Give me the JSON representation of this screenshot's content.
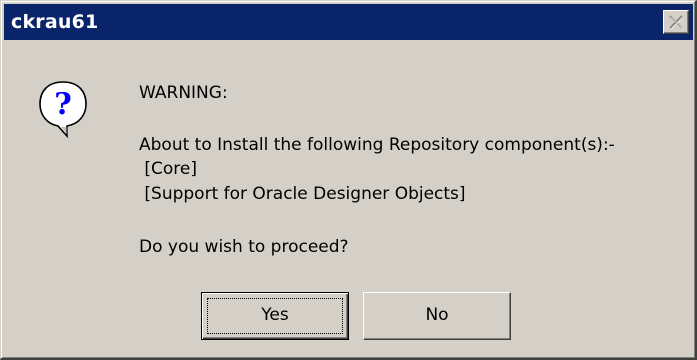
{
  "window": {
    "title": "ckrau61",
    "close_icon": "close-icon"
  },
  "message": {
    "icon": "question-icon",
    "warning": "WARNING:",
    "install_line": "About to Install the following Repository component(s):-",
    "components": [
      " [Core]",
      " [Support for Oracle Designer Objects]"
    ],
    "prompt": "Do you wish to proceed?"
  },
  "buttons": {
    "yes_label": "Yes",
    "no_label": "No"
  },
  "colors": {
    "titlebar": "#0a246a",
    "dialog_bg": "#d4d0c8",
    "icon_blue": "#0000ff"
  }
}
